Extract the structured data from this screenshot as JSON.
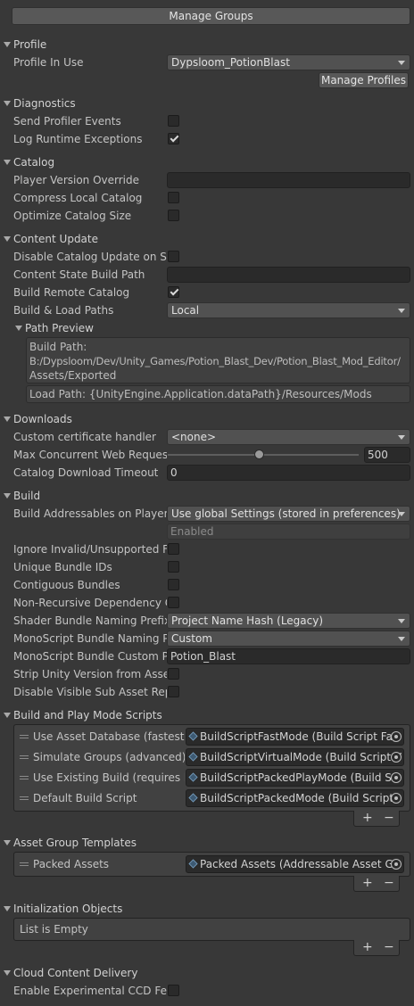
{
  "manage_groups_label": "Manage Groups",
  "profile": {
    "header": "Profile",
    "profile_in_use_label": "Profile In Use",
    "profile_in_use_value": "Dypsloom_PotionBlast",
    "manage_profiles_label": "Manage Profiles"
  },
  "diagnostics": {
    "header": "Diagnostics",
    "send_profiler_events_label": "Send Profiler Events",
    "send_profiler_events": false,
    "log_runtime_exceptions_label": "Log Runtime Exceptions",
    "log_runtime_exceptions": true
  },
  "catalog": {
    "header": "Catalog",
    "player_version_override_label": "Player Version Override",
    "player_version_override_value": "",
    "compress_local_catalog_label": "Compress Local Catalog",
    "optimize_catalog_size_label": "Optimize Catalog Size"
  },
  "content_update": {
    "header": "Content Update",
    "disable_catalog_update_label": "Disable Catalog Update on Sta",
    "content_state_build_path_label": "Content State Build Path",
    "content_state_build_path_value": "",
    "build_remote_catalog_label": "Build Remote Catalog",
    "build_remote_catalog": true,
    "build_load_paths_label": "Build & Load Paths",
    "build_load_paths_value": "Local",
    "path_preview_header": "Path Preview",
    "build_path_line1": "Build Path:",
    "build_path_line2": "B:/Dypsloom/Dev/Unity_Games/Potion_Blast_Dev/Potion_Blast_Mod_Editor/",
    "build_path_line3": "Assets/Exported",
    "load_path": "Load Path: {UnityEngine.Application.dataPath}/Resources/Mods"
  },
  "downloads": {
    "header": "Downloads",
    "custom_certificate_handler_label": "Custom certificate handler",
    "custom_certificate_handler_value": "<none>",
    "max_concurrent_label": "Max Concurrent Web Requests",
    "max_concurrent_value": "500",
    "max_concurrent_fraction": 0.48,
    "catalog_download_timeout_label": "Catalog Download Timeout",
    "catalog_download_timeout_value": "0"
  },
  "build": {
    "header": "Build",
    "build_addressables_label": "Build Addressables on Player E",
    "build_addressables_value": "Use global Settings (stored in preferences)",
    "enabled_text": "Enabled",
    "ignore_invalid_label": "Ignore Invalid/Unsupported File",
    "unique_bundle_ids_label": "Unique Bundle IDs",
    "contiguous_bundles_label": "Contiguous Bundles",
    "non_recursive_label": "Non-Recursive Dependency C",
    "shader_bundle_naming_label": "Shader Bundle Naming Prefix",
    "shader_bundle_naming_value": "Project Name Hash (Legacy)",
    "monoscript_naming_label": "MonoScript Bundle Naming Pre",
    "monoscript_naming_value": "Custom",
    "monoscript_custom_label": "MonoScript Bundle Custom Pre",
    "monoscript_custom_value": "Potion_Blast",
    "strip_unity_version_label": "Strip Unity Version from AssetB",
    "disable_visible_sub_asset_label": "Disable Visible Sub Asset Repr"
  },
  "build_play_mode_scripts": {
    "header": "Build and Play Mode Scripts",
    "items": [
      {
        "label": "Use Asset Database (fastest)",
        "value": "BuildScriptFastMode (Build Script Fas"
      },
      {
        "label": "Simulate Groups (advanced)",
        "value": "BuildScriptVirtualMode (Build Script V"
      },
      {
        "label": "Use Existing Build (requires bui",
        "value": "BuildScriptPackedPlayMode (Build Sc"
      },
      {
        "label": "Default Build Script",
        "value": "BuildScriptPackedMode (Build Script"
      }
    ],
    "plus": "+",
    "minus": "−"
  },
  "asset_group_templates": {
    "header": "Asset Group Templates",
    "items": [
      {
        "label": "Packed Assets",
        "value": "Packed Assets (Addressable Asset Gr"
      }
    ],
    "plus": "+",
    "minus": "−"
  },
  "initialization_objects": {
    "header": "Initialization Objects",
    "empty_text": "List is Empty",
    "plus": "+",
    "minus": "−"
  },
  "cloud_content_delivery": {
    "header": "Cloud Content Delivery",
    "enable_ccd_label": "Enable Experimental CCD Feat"
  },
  "colors": {
    "background": "#383838",
    "field": "#2a2a2a",
    "dropdown": "#515151",
    "text": "#c4c4c4"
  }
}
